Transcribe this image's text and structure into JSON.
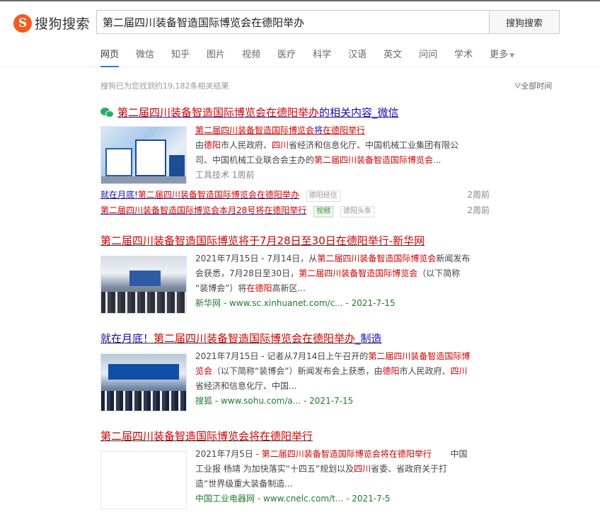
{
  "header": {
    "logo_badge": "S",
    "logo_text": "搜狗搜索",
    "search_value": "第二届四川装备智造国际博览会在德阳举办",
    "search_button": "搜狗搜索"
  },
  "tabs": [
    {
      "label": "网页",
      "active": true
    },
    {
      "label": "微信"
    },
    {
      "label": "知乎"
    },
    {
      "label": "图片"
    },
    {
      "label": "视频"
    },
    {
      "label": "医疗"
    },
    {
      "label": "科学"
    },
    {
      "label": "汉语"
    },
    {
      "label": "英文"
    },
    {
      "label": "问问"
    },
    {
      "label": "学术"
    },
    {
      "label": "更多"
    }
  ],
  "summary": {
    "count_text": "搜狗已为您找到约19,182条相关结果",
    "time_filter": "全部时间"
  },
  "wechat": {
    "title_em": "第二届四川装备智造国际博览会在德阳举办",
    "title_rest": "的相关内容_微信",
    "card_title_em": "第二届四川装备智造国际博览会",
    "card_title_mid": "将",
    "card_title_em2": "在德阳举行",
    "line1_a": "由",
    "line1_em1": "德阳",
    "line1_b": "市人民政府、",
    "line1_em2": "四川",
    "line1_c": "省经济和信息化厅、中国机械工业集团有限公",
    "line2_a": "司、中国机械工业联合会主办的",
    "line2_em": "第二届四川装备智造国际博览会",
    "line2_b": "...",
    "meta": "工具技术   1周前",
    "sub1_em": "第二届四川装备智造国际博览会在德阳举办",
    "sub1_pre": "就在月底!",
    "sub1_tag": "德阳经信",
    "sub1_time": "2周前",
    "sub2_em": "第二届四川装备智造国际博览会",
    "sub2_mid": "本月28号将",
    "sub2_em2": "在德阳举行",
    "sub2_video": "视频",
    "sub2_tag": "德阳头条",
    "sub2_time": "2周前"
  },
  "results": [
    {
      "title_em": "第二届四川装备智造国际博览",
      "title_rest": "将于7月28日至30日",
      "title_em2": "在德阳举行",
      "title_tail": "-新华网",
      "line1_a": "2021年7月15日 - 7月14日，从",
      "line1_em": "第二届四川装备智造国际博览会",
      "line1_b": "新闻发布",
      "line2_a": "会获悉，7月28日至30日，",
      "line2_em": "第二届四川装备智造国际博览会",
      "line2_b": "（以下简称",
      "line3_a": "“装博会”）将",
      "line3_em": "在德阳",
      "line3_b": "高新区...",
      "source": "新华网 - www.sc.xinhuanet.com/c... - 2021-7-15"
    },
    {
      "title_pre": "就在月底！",
      "title_em": "第二届四川装备智造国际博览会在德阳举办",
      "title_tail": "_制造",
      "line1_a": "2021年7月15日 - 记者从7月14日上午召开的",
      "line1_em": "第二届四川装备智造国际博",
      "line2_em": "览会",
      "line2_b": "（以下简称“装博会”）新闻发布会上获悉，由",
      "line2_em2": "德阳",
      "line2_c": "市人民政府、",
      "line2_em3": "四川",
      "line3_a": "省经济和信息化厅、中国...",
      "source": "搜狐 - www.sohu.com/a... - 2021-7-15"
    },
    {
      "title_em": "第二届四川装备智造国际博览会",
      "title_mid": "将",
      "title_em2": "在德阳举行",
      "line1_a": "2021年7月5日 - ",
      "line1_em": "第二届四川装备智造国际博览会",
      "line1_b": "将",
      "line1_em2": "在德阳举行",
      "line1_c": "中国",
      "line2_a": "工业报 杨靖        为加快落实“十四五”规划以及",
      "line2_em": "四川",
      "line2_b": "省委、省政府关于打",
      "line3_a": "造“世界级重大装备制造...",
      "source": "中国工业电器网 - www.cnelc.com/t... - 2021-7-5"
    }
  ]
}
